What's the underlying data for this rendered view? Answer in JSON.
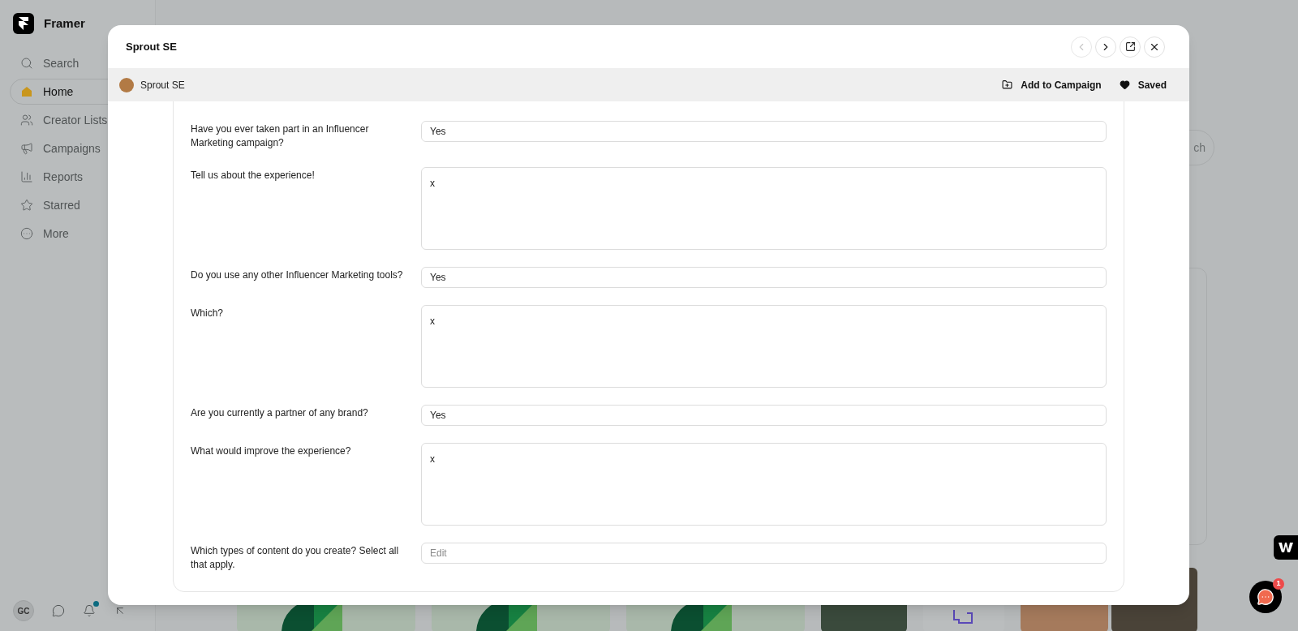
{
  "sidebar": {
    "brand": "Framer",
    "items": [
      {
        "label": "Search",
        "selected": false
      },
      {
        "label": "Home",
        "selected": true
      },
      {
        "label": "Creator Lists",
        "selected": false
      },
      {
        "label": "Campaigns",
        "selected": false
      },
      {
        "label": "Reports",
        "selected": false
      },
      {
        "label": "Starred",
        "selected": false
      },
      {
        "label": "More",
        "selected": false
      }
    ],
    "user_initials": "GC",
    "notifications_unread": true
  },
  "background": {
    "button_fragment": "ch"
  },
  "modal": {
    "title": "Sprout SE",
    "profile_name": "Sprout SE",
    "actions": [
      {
        "kind": "campaign",
        "label": "Add to Campaign"
      },
      {
        "kind": "saved",
        "label": "Saved"
      }
    ],
    "prev_disabled": true,
    "questions": [
      {
        "kind": "input",
        "label": "Have you ever taken part in an Influencer Marketing campaign?",
        "value": "Yes"
      },
      {
        "kind": "textarea",
        "label": "Tell us about the experience!",
        "value": "x"
      },
      {
        "kind": "input",
        "label": "Do you use any other Influencer Marketing tools?",
        "value": "Yes"
      },
      {
        "kind": "textarea",
        "label": "Which?",
        "value": "x"
      },
      {
        "kind": "input",
        "label": "Are you currently a partner of any brand?",
        "value": "Yes"
      },
      {
        "kind": "textarea",
        "label": "What would improve the experience?",
        "value": "x"
      },
      {
        "kind": "input",
        "label": "Which types of content do you create? Select all that apply.",
        "placeholder": "Edit"
      }
    ]
  },
  "chat": {
    "badge": "1"
  }
}
